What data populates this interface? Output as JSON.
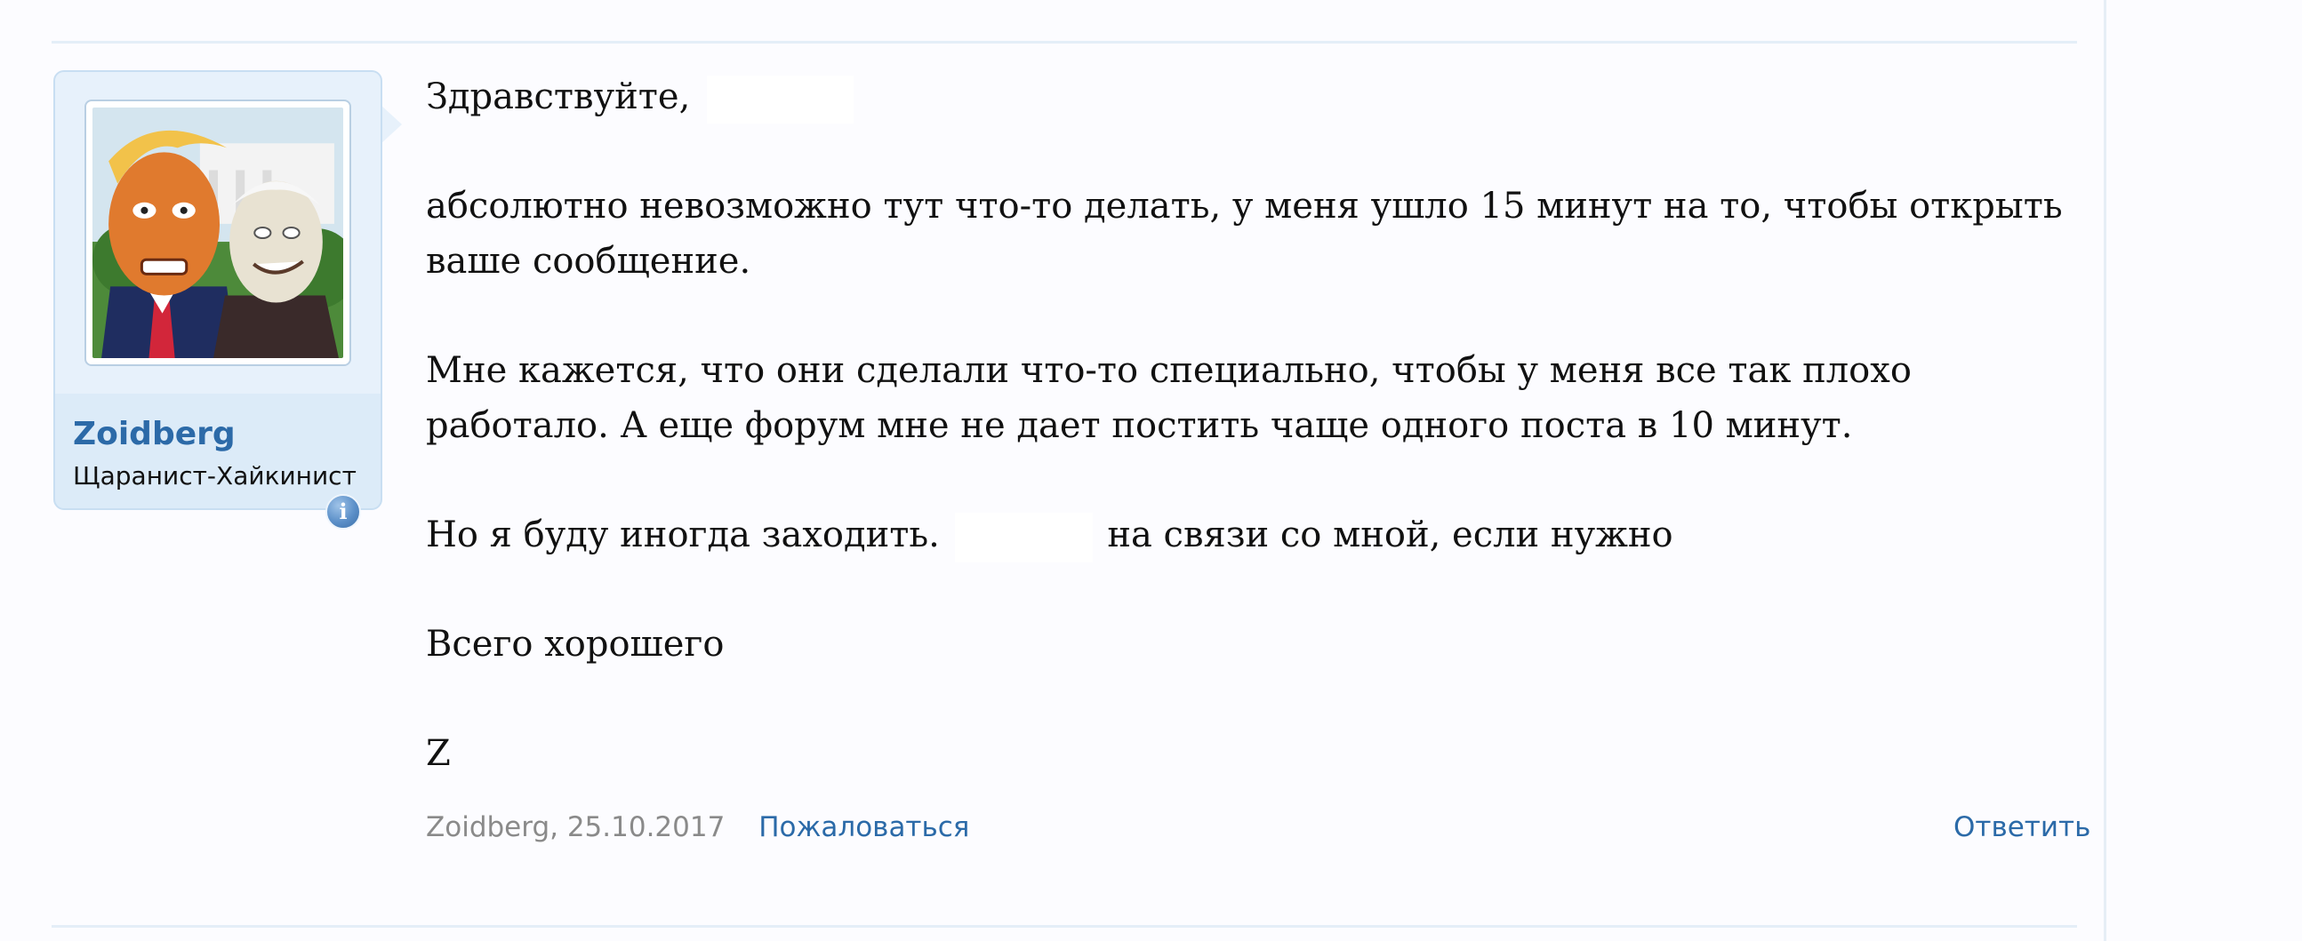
{
  "user": {
    "name": "Zoidberg",
    "title": "Щаранист-Хайкинист",
    "avatar_icon": "cartoon-avatar",
    "info_icon": "info-icon"
  },
  "message": {
    "greeting": "Здравствуйте,",
    "line1": "абсолютно невозможно тут что-то делать, у меня ушло 15 минут на то, чтобы открыть ваше сообщение.",
    "line2": "Мне кажется, что они сделали что-то специально, чтобы у меня все так плохо работало. А еще форум мне не дает постить чаще одного поста в 10 минут.",
    "line3_before": "Но я буду иногда заходить.",
    "line3_after": "на связи со мной, если нужно",
    "line4": "Всего хорошего",
    "signature": "Z"
  },
  "footer": {
    "author_date": "Zoidberg, 25.10.2017",
    "report_label": "Пожаловаться",
    "reply_label": "Ответить"
  },
  "colors": {
    "link": "#2b6aa8",
    "username": "#2c6aa8",
    "panel": "#dcebf8",
    "page_bg": "#fcfcff"
  }
}
